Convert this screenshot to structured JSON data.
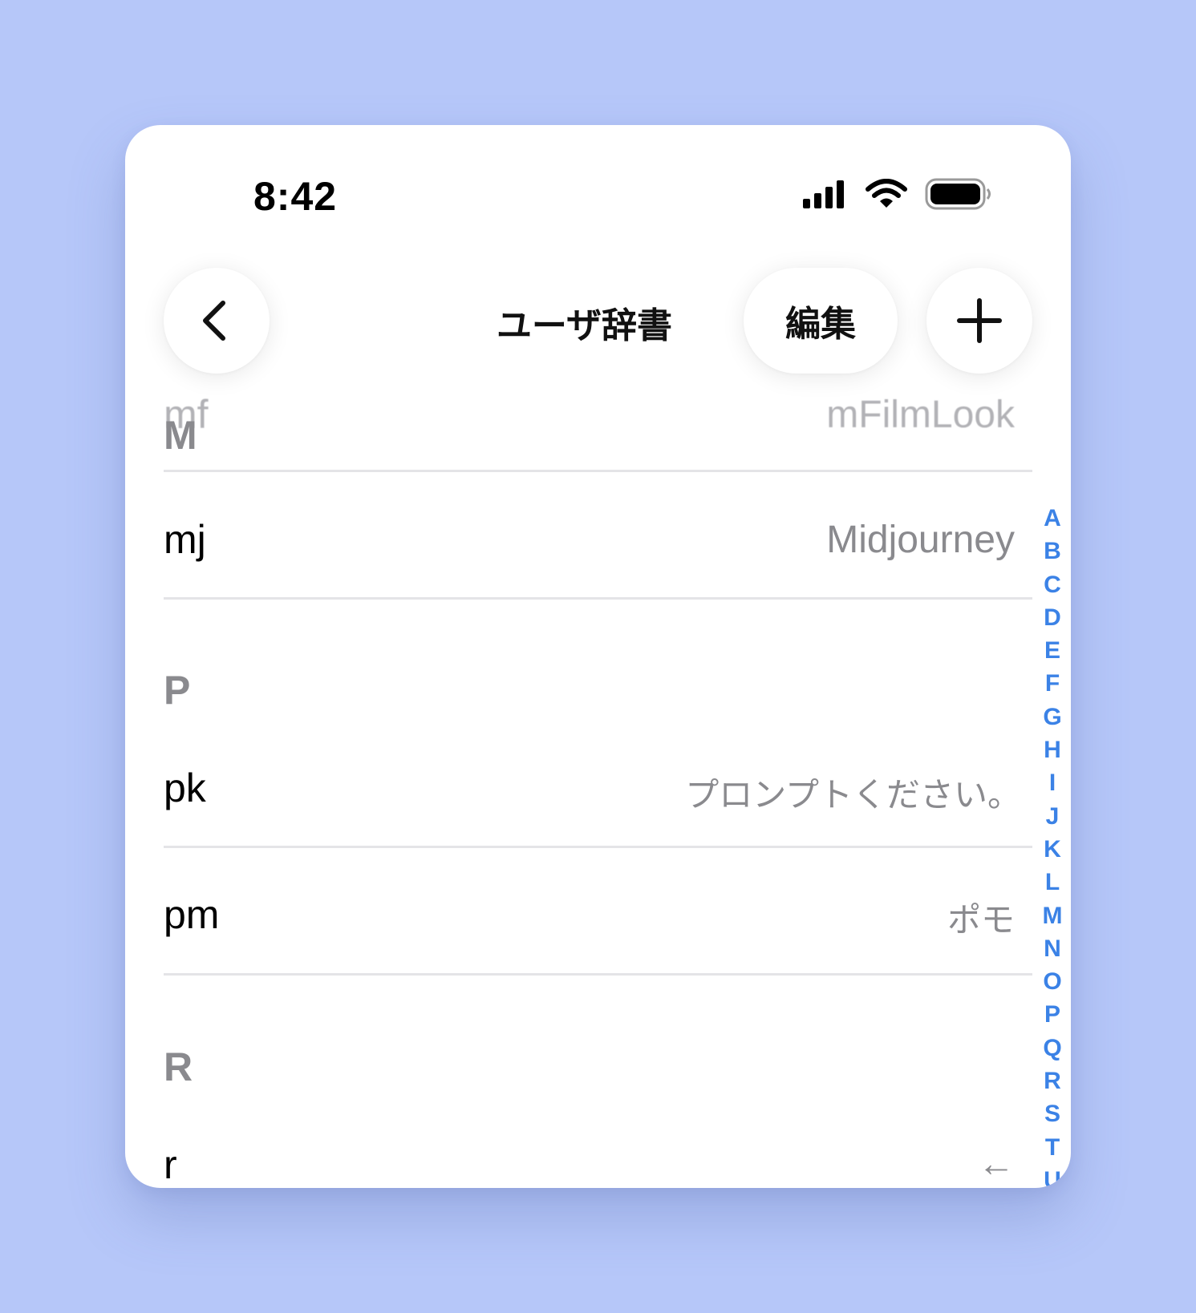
{
  "status_bar": {
    "time": "8:42",
    "icons": [
      "signal-icon",
      "wifi-icon",
      "battery-icon"
    ]
  },
  "nav": {
    "back_icon": "chevron-left-icon",
    "title": "ユーザ辞書",
    "edit_label": "編集",
    "add_icon": "plus-icon"
  },
  "list": {
    "faded_row": {
      "key": "mf",
      "value": "mFilmLook"
    },
    "sections": [
      {
        "header": "M",
        "rows": [
          {
            "key": "mj",
            "value": "Midjourney"
          }
        ]
      },
      {
        "header": "P",
        "rows": [
          {
            "key": "pk",
            "value": "プロンプトください。"
          },
          {
            "key": "pm",
            "value": "ポモ"
          }
        ]
      },
      {
        "header": "R",
        "rows": [
          {
            "key": "r",
            "value": "←"
          }
        ]
      }
    ]
  },
  "index": [
    "A",
    "B",
    "C",
    "D",
    "E",
    "F",
    "G",
    "H",
    "I",
    "J",
    "K",
    "L",
    "M",
    "N",
    "O",
    "P",
    "Q",
    "R",
    "S",
    "T",
    "U"
  ],
  "colors": {
    "background": "#b6c7f9",
    "index_accent": "#3b82e6",
    "secondary_text": "#8a8a8e"
  }
}
